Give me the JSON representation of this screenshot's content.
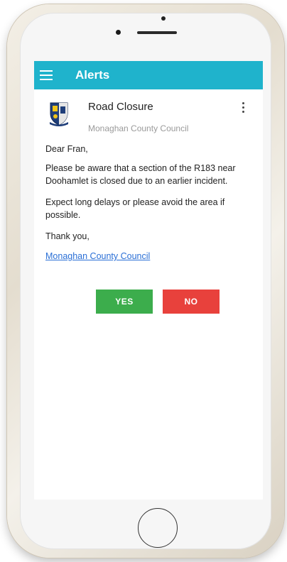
{
  "app_bar": {
    "title": "Alerts"
  },
  "alert": {
    "title": "Road Closure",
    "source": "Monaghan County Council",
    "greeting": "Dear Fran,",
    "paragraph1": "Please be aware that a section of the R183 near Doohamlet is closed due to an earlier incident.",
    "paragraph2": "Expect long delays or please avoid the area if possible.",
    "closing": "Thank you,",
    "sender_link": "Monaghan County Council"
  },
  "actions": {
    "yes_label": "YES",
    "no_label": "NO"
  },
  "colors": {
    "app_bar": "#1fb3cc",
    "yes_button": "#3cad4c",
    "no_button": "#e8413c",
    "link": "#2a6fd6"
  },
  "icons": [
    "menu-icon",
    "council-crest-icon",
    "more-vertical-icon"
  ]
}
